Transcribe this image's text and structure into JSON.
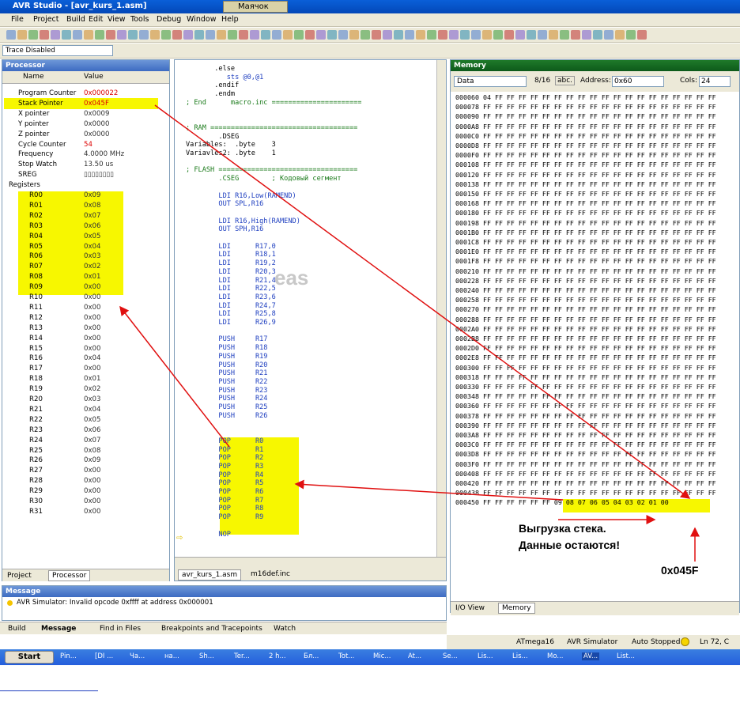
{
  "window": {
    "title": "AVR Studio - [avr_kurs_1.asm]",
    "second_tab": "Маячок"
  },
  "menu": [
    "File",
    "Project",
    "Build",
    "Edit",
    "View",
    "Tools",
    "Debug",
    "Window",
    "Help"
  ],
  "toolbar": {
    "trace_select": "Trace Disabled"
  },
  "processor": {
    "title": "Processor",
    "col_name": "Name",
    "col_value": "Value",
    "rows": [
      {
        "name": "Program Counter",
        "value": "0x000022",
        "red": true
      },
      {
        "name": "Stack Pointer",
        "value": "0x045F",
        "red": true
      },
      {
        "name": "X pointer",
        "value": "0x0009"
      },
      {
        "name": "Y pointer",
        "value": "0x0000"
      },
      {
        "name": "Z pointer",
        "value": "0x0000"
      },
      {
        "name": "Cycle Counter",
        "value": "54",
        "red": true
      },
      {
        "name": "Frequency",
        "value": "4.0000 MHz"
      },
      {
        "name": "Stop Watch",
        "value": "13.50 us"
      },
      {
        "name": "SREG",
        "value": "▯▯▯▯▯▯▯▯"
      },
      {
        "name": "Registers",
        "value": ""
      }
    ],
    "registers": [
      {
        "name": "R00",
        "value": "0x09"
      },
      {
        "name": "R01",
        "value": "0x08"
      },
      {
        "name": "R02",
        "value": "0x07"
      },
      {
        "name": "R03",
        "value": "0x06"
      },
      {
        "name": "R04",
        "value": "0x05"
      },
      {
        "name": "R05",
        "value": "0x04"
      },
      {
        "name": "R06",
        "value": "0x03"
      },
      {
        "name": "R07",
        "value": "0x02"
      },
      {
        "name": "R08",
        "value": "0x01"
      },
      {
        "name": "R09",
        "value": "0x00"
      },
      {
        "name": "R10",
        "value": "0x00"
      },
      {
        "name": "R11",
        "value": "0x00"
      },
      {
        "name": "R12",
        "value": "0x00"
      },
      {
        "name": "R13",
        "value": "0x00"
      },
      {
        "name": "R14",
        "value": "0x00"
      },
      {
        "name": "R15",
        "value": "0x00"
      },
      {
        "name": "R16",
        "value": "0x04"
      },
      {
        "name": "R17",
        "value": "0x00"
      },
      {
        "name": "R18",
        "value": "0x01"
      },
      {
        "name": "R19",
        "value": "0x02"
      },
      {
        "name": "R20",
        "value": "0x03"
      },
      {
        "name": "R21",
        "value": "0x04"
      },
      {
        "name": "R22",
        "value": "0x05"
      },
      {
        "name": "R23",
        "value": "0x06"
      },
      {
        "name": "R24",
        "value": "0x07"
      },
      {
        "name": "R25",
        "value": "0x08"
      },
      {
        "name": "R26",
        "value": "0x09"
      },
      {
        "name": "R27",
        "value": "0x00"
      },
      {
        "name": "R28",
        "value": "0x00"
      },
      {
        "name": "R29",
        "value": "0x00"
      },
      {
        "name": "R30",
        "value": "0x00"
      },
      {
        "name": "R31",
        "value": "0x00"
      }
    ],
    "tabs": [
      "Project",
      "Processor"
    ]
  },
  "code": {
    "lines": [
      {
        "t": "       .else",
        "c": ""
      },
      {
        "t": "          sts @0,@1",
        "c": "blue"
      },
      {
        "t": "       .endif",
        "c": ""
      },
      {
        "t": "       .endm",
        "c": ""
      },
      {
        "t": "; End      macro.inc ======================",
        "c": "com"
      },
      {
        "t": "",
        "c": ""
      },
      {
        "t": "",
        "c": ""
      },
      {
        "t": "; RAM ====================================",
        "c": "com"
      },
      {
        "t": "        .DSEG",
        "c": ""
      },
      {
        "t": "Variables:  .byte    3",
        "c": ""
      },
      {
        "t": "Variavles2: .byte    1",
        "c": ""
      },
      {
        "t": "",
        "c": ""
      },
      {
        "t": "; FLASH ==================================",
        "c": "com"
      },
      {
        "t": "        .CSEG        ; Кодовый сегмент",
        "c": "com"
      },
      {
        "t": "",
        "c": ""
      },
      {
        "t": "        LDI R16,Low(RAMEND)",
        "c": "blue"
      },
      {
        "t": "        OUT SPL,R16",
        "c": "blue"
      },
      {
        "t": "",
        "c": ""
      },
      {
        "t": "        LDI R16,High(RAMEND)",
        "c": "blue"
      },
      {
        "t": "        OUT SPH,R16",
        "c": "blue"
      },
      {
        "t": "",
        "c": ""
      },
      {
        "t": "        LDI      R17,0",
        "c": "blue"
      },
      {
        "t": "        LDI      R18,1",
        "c": "blue"
      },
      {
        "t": "        LDI      R19,2",
        "c": "blue"
      },
      {
        "t": "        LDI      R20,3",
        "c": "blue"
      },
      {
        "t": "        LDI      R21,4",
        "c": "blue"
      },
      {
        "t": "        LDI      R22,5",
        "c": "blue"
      },
      {
        "t": "        LDI      R23,6",
        "c": "blue"
      },
      {
        "t": "        LDI      R24,7",
        "c": "blue"
      },
      {
        "t": "        LDI      R25,8",
        "c": "blue"
      },
      {
        "t": "        LDI      R26,9",
        "c": "blue"
      },
      {
        "t": "",
        "c": ""
      },
      {
        "t": "        PUSH     R17",
        "c": "blue"
      },
      {
        "t": "        PUSH     R18",
        "c": "blue"
      },
      {
        "t": "        PUSH     R19",
        "c": "blue"
      },
      {
        "t": "        PUSH     R20",
        "c": "blue"
      },
      {
        "t": "        PUSH     R21",
        "c": "blue"
      },
      {
        "t": "        PUSH     R22",
        "c": "blue"
      },
      {
        "t": "        PUSH     R23",
        "c": "blue"
      },
      {
        "t": "        PUSH     R24",
        "c": "blue"
      },
      {
        "t": "        PUSH     R25",
        "c": "blue"
      },
      {
        "t": "        PUSH     R26",
        "c": "blue"
      },
      {
        "t": "",
        "c": ""
      },
      {
        "t": "",
        "c": ""
      },
      {
        "t": "        POP      R0",
        "c": "blue"
      },
      {
        "t": "        POP      R1",
        "c": "blue"
      },
      {
        "t": "        POP      R2",
        "c": "blue"
      },
      {
        "t": "        POP      R3",
        "c": "blue"
      },
      {
        "t": "        POP      R4",
        "c": "blue"
      },
      {
        "t": "        POP      R5",
        "c": "blue"
      },
      {
        "t": "        POP      R6",
        "c": "blue"
      },
      {
        "t": "        POP      R7",
        "c": "blue"
      },
      {
        "t": "        POP      R8",
        "c": "blue"
      },
      {
        "t": "        POP      R9",
        "c": "blue"
      },
      {
        "t": "",
        "c": ""
      },
      {
        "t": "        NOP",
        "c": "blue"
      }
    ],
    "tabs": [
      "avr_kurs_1.asm",
      "m16def.inc"
    ],
    "watermark": "eas"
  },
  "memory": {
    "title": "Memory",
    "type": "Data",
    "sizes": "8/16",
    "abc": "abc.",
    "address_label": "Address:",
    "address": "0x60",
    "cols_label": "Cols:",
    "cols": "24",
    "rows": [
      "000060 04 FF FF FF FF FF FF FF FF FF FF FF FF FF FF FF FF FF FF FF",
      "000078 FF FF FF FF FF FF FF FF FF FF FF FF FF FF FF FF FF FF FF FF",
      "000090 FF FF FF FF FF FF FF FF FF FF FF FF FF FF FF FF FF FF FF FF",
      "0000A8 FF FF FF FF FF FF FF FF FF FF FF FF FF FF FF FF FF FF FF FF",
      "0000C0 FF FF FF FF FF FF FF FF FF FF FF FF FF FF FF FF FF FF FF FF",
      "0000D8 FF FF FF FF FF FF FF FF FF FF FF FF FF FF FF FF FF FF FF FF",
      "0000F0 FF FF FF FF FF FF FF FF FF FF FF FF FF FF FF FF FF FF FF FF",
      "000108 FF FF FF FF FF FF FF FF FF FF FF FF FF FF FF FF FF FF FF FF",
      "000120 FF FF FF FF FF FF FF FF FF FF FF FF FF FF FF FF FF FF FF FF",
      "000138 FF FF FF FF FF FF FF FF FF FF FF FF FF FF FF FF FF FF FF FF",
      "000150 FF FF FF FF FF FF FF FF FF FF FF FF FF FF FF FF FF FF FF FF",
      "000168 FF FF FF FF FF FF FF FF FF FF FF FF FF FF FF FF FF FF FF FF",
      "000180 FF FF FF FF FF FF FF FF FF FF FF FF FF FF FF FF FF FF FF FF",
      "000198 FF FF FF FF FF FF FF FF FF FF FF FF FF FF FF FF FF FF FF FF",
      "0001B0 FF FF FF FF FF FF FF FF FF FF FF FF FF FF FF FF FF FF FF FF",
      "0001C8 FF FF FF FF FF FF FF FF FF FF FF FF FF FF FF FF FF FF FF FF",
      "0001E0 FF FF FF FF FF FF FF FF FF FF FF FF FF FF FF FF FF FF FF FF",
      "0001F8 FF FF FF FF FF FF FF FF FF FF FF FF FF FF FF FF FF FF FF FF",
      "000210 FF FF FF FF FF FF FF FF FF FF FF FF FF FF FF FF FF FF FF FF",
      "000228 FF FF FF FF FF FF FF FF FF FF FF FF FF FF FF FF FF FF FF FF",
      "000240 FF FF FF FF FF FF FF FF FF FF FF FF FF FF FF FF FF FF FF FF",
      "000258 FF FF FF FF FF FF FF FF FF FF FF FF FF FF FF FF FF FF FF FF",
      "000270 FF FF FF FF FF FF FF FF FF FF FF FF FF FF FF FF FF FF FF FF",
      "000288 FF FF FF FF FF FF FF FF FF FF FF FF FF FF FF FF FF FF FF FF",
      "0002A0 FF FF FF FF FF FF FF FF FF FF FF FF FF FF FF FF FF FF FF FF",
      "0002B8 FF FF FF FF FF FF FF FF FF FF FF FF FF FF FF FF FF FF FF FF",
      "0002D0 FF FF FF FF FF FF FF FF FF FF FF FF FF FF FF FF FF FF FF FF",
      "0002E8 FF FF FF FF FF FF FF FF FF FF FF FF FF FF FF FF FF FF FF FF",
      "000300 FF FF FF FF FF FF FF FF FF FF FF FF FF FF FF FF FF FF FF FF",
      "000318 FF FF FF FF FF FF FF FF FF FF FF FF FF FF FF FF FF FF FF FF",
      "000330 FF FF FF FF FF FF FF FF FF FF FF FF FF FF FF FF FF FF FF FF",
      "000348 FF FF FF FF FF FF FF FF FF FF FF FF FF FF FF FF FF FF FF FF",
      "000360 FF FF FF FF FF FF FF FF FF FF FF FF FF FF FF FF FF FF FF FF",
      "000378 FF FF FF FF FF FF FF FF FF FF FF FF FF FF FF FF FF FF FF FF",
      "000390 FF FF FF FF FF FF FF FF FF FF FF FF FF FF FF FF FF FF FF FF",
      "0003A8 FF FF FF FF FF FF FF FF FF FF FF FF FF FF FF FF FF FF FF FF",
      "0003C0 FF FF FF FF FF FF FF FF FF FF FF FF FF FF FF FF FF FF FF FF",
      "0003D8 FF FF FF FF FF FF FF FF FF FF FF FF FF FF FF FF FF FF FF FF",
      "0003F0 FF FF FF FF FF FF FF FF FF FF FF FF FF FF FF FF FF FF FF FF",
      "000408 FF FF FF FF FF FF FF FF FF FF FF FF FF FF FF FF FF FF FF FF",
      "000420 FF FF FF FF FF FF FF FF FF FF FF FF FF FF FF FF FF FF FF FF",
      "000438 FF FF FF FF FF FF FF FF FF FF FF FF FF FF FF FF FF FF FF FF",
      "000450 FF FF FF FF FF FF 09 08 07 06 05 04 03 02 01 00"
    ],
    "tabs": [
      "I/O View",
      "Memory"
    ]
  },
  "message": {
    "title": "Message",
    "text": "AVR Simulator: Invalid opcode 0xffff at address 0x000001"
  },
  "bottom_tabs": [
    "Build",
    "Message",
    "Find in Files",
    "Breakpoints and Tracepoints",
    "Watch"
  ],
  "status": {
    "device": "ATmega16",
    "platform": "AVR Simulator",
    "mode": "Auto",
    "state": "Stopped",
    "pos": "Ln 72, C"
  },
  "taskbar": {
    "start": "Start",
    "items": [
      "Pin...",
      "[DI ...",
      "Ча...",
      "на...",
      "Sh...",
      "Ter...",
      "2 h...",
      "Бл...",
      "Tot...",
      "Mic...",
      "At...",
      "Se...",
      "Lis...",
      "Lis...",
      "Mo...",
      "AV...",
      "List..."
    ]
  },
  "annotations": {
    "line1": "Выгрузка стека.",
    "line2": "Данные остаются!",
    "sp": "0x045F"
  },
  "colors": {
    "highlight": "#f7f700",
    "arrow": "#e01010"
  }
}
